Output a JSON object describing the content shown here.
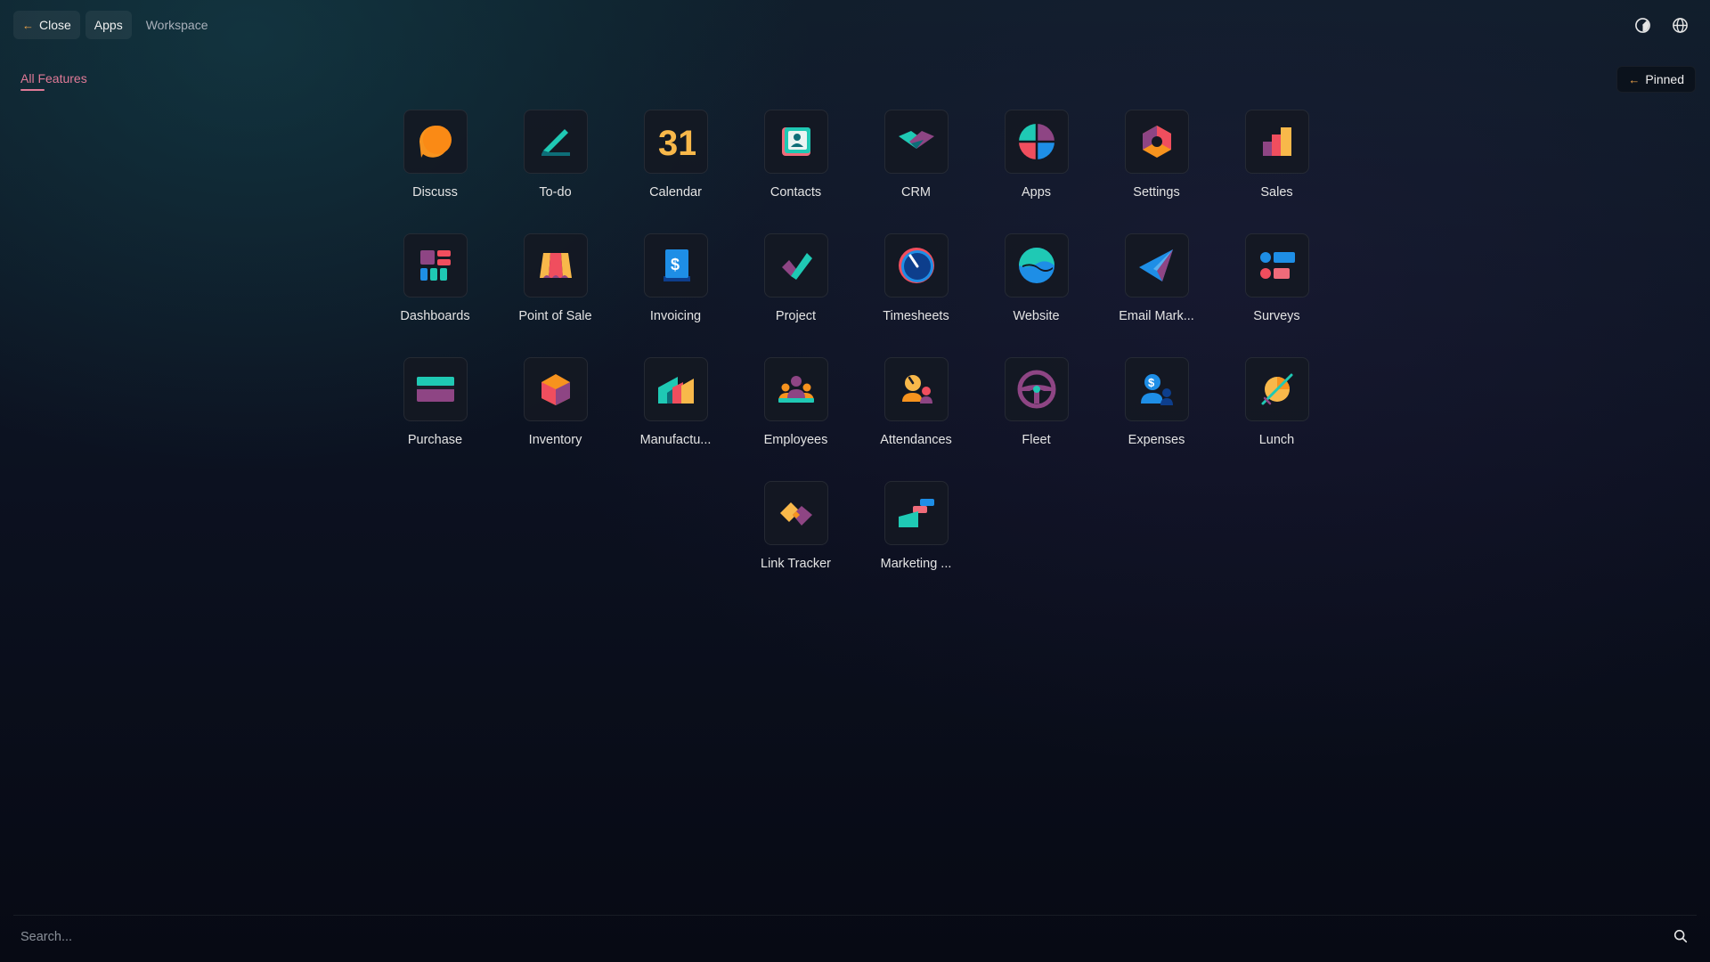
{
  "topbar": {
    "close_label": "Close",
    "apps_label": "Apps",
    "workspace_label": "Workspace"
  },
  "section": {
    "title": "All Features"
  },
  "pinned_label": "Pinned",
  "apps": [
    {
      "label": "Discuss",
      "icon": "discuss-icon"
    },
    {
      "label": "To-do",
      "icon": "todo-icon"
    },
    {
      "label": "Calendar",
      "icon": "calendar-icon",
      "glyph": "31"
    },
    {
      "label": "Contacts",
      "icon": "contacts-icon"
    },
    {
      "label": "CRM",
      "icon": "crm-icon"
    },
    {
      "label": "Apps",
      "icon": "apps-icon"
    },
    {
      "label": "Settings",
      "icon": "settings-icon"
    },
    {
      "label": "Sales",
      "icon": "sales-icon"
    },
    {
      "label": "Dashboards",
      "icon": "dashboards-icon"
    },
    {
      "label": "Point of Sale",
      "icon": "point-of-sale-icon"
    },
    {
      "label": "Invoicing",
      "icon": "invoicing-icon",
      "glyph": "$"
    },
    {
      "label": "Project",
      "icon": "project-icon"
    },
    {
      "label": "Timesheets",
      "icon": "timesheets-icon"
    },
    {
      "label": "Website",
      "icon": "website-icon"
    },
    {
      "label": "Email Mark...",
      "icon": "email-marketing-icon"
    },
    {
      "label": "Surveys",
      "icon": "surveys-icon"
    },
    {
      "label": "Purchase",
      "icon": "purchase-icon"
    },
    {
      "label": "Inventory",
      "icon": "inventory-icon"
    },
    {
      "label": "Manufactu...",
      "icon": "manufacturing-icon"
    },
    {
      "label": "Employees",
      "icon": "employees-icon"
    },
    {
      "label": "Attendances",
      "icon": "attendances-icon"
    },
    {
      "label": "Fleet",
      "icon": "fleet-icon"
    },
    {
      "label": "Expenses",
      "icon": "expenses-icon",
      "glyph": "$"
    },
    {
      "label": "Lunch",
      "icon": "lunch-icon"
    },
    {
      "label": "Link Tracker",
      "icon": "link-tracker-icon"
    },
    {
      "label": "Marketing ...",
      "icon": "marketing-automation-icon"
    }
  ],
  "search": {
    "placeholder": "Search..."
  },
  "colors": {
    "accent": "#e07a97",
    "orange": "#f7931e",
    "teal": "#1fc9b4",
    "purple": "#8e4584",
    "red": "#f04e5e",
    "blue": "#1e8ee6",
    "yellow": "#f8b84a"
  }
}
